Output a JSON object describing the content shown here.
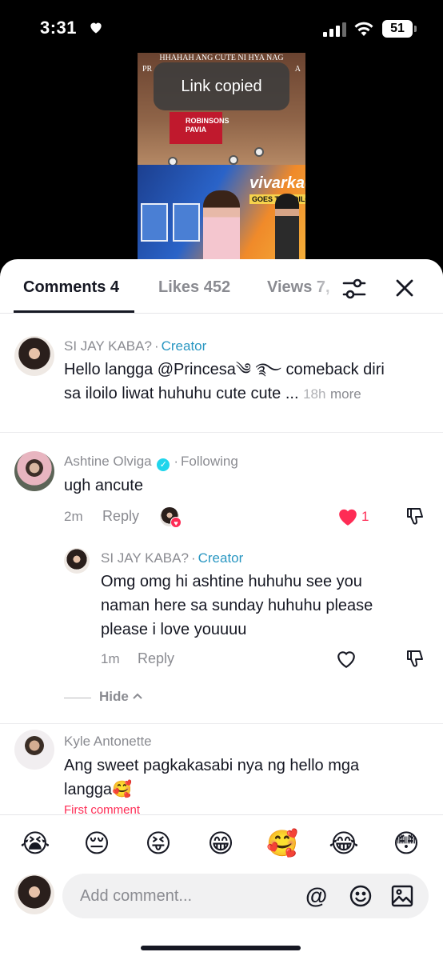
{
  "status": {
    "time": "3:31",
    "battery": "51"
  },
  "video": {
    "caption_line1": "HHAHAH ANG CUTE NI HYA NAG",
    "caption_line2": "PR",
    "caption_line2_end": "A",
    "sign": "ROBINSONS PAVIA",
    "board": "vivarkada",
    "board_sub": "GOES TO ILOILO",
    "toast": "Link copied"
  },
  "tabs": [
    {
      "label": "Comments 4"
    },
    {
      "label": "Likes 452"
    },
    {
      "label": "Views 7,"
    }
  ],
  "comments": [
    {
      "name": "SI JAY KABA?",
      "badge": "Creator",
      "text_line1": "Hello langga @Princesa༄ ࿐ comeback diri",
      "text_line2": "sa iloilo liwat huhuhu cute cute ...",
      "time": "18h",
      "more": "more"
    },
    {
      "name": "Ashtine Olviga",
      "badge": "Following",
      "text": "ugh ancute",
      "time": "2m",
      "reply": "Reply",
      "likes": "1"
    },
    {
      "name": "SI JAY KABA?",
      "badge": "Creator",
      "text_line1": "Omg omg hi ashtine huhuhu see you",
      "text_line2": "naman here sa sunday huhuhu please",
      "text_line3": "please i love youuuu",
      "time": "1m",
      "reply": "Reply"
    },
    {
      "name": "Kyle Antonette",
      "text_line1": "Ang sweet pagkakasabi nya ng hello mga",
      "text_line2": "langga🥰",
      "tag": "First comment"
    }
  ],
  "hide_label": "Hide",
  "emojis": [
    "😭",
    "😔",
    "😝",
    "😁",
    "🥰",
    "😂",
    "😳"
  ],
  "input": {
    "placeholder": "Add comment...",
    "at": "@"
  },
  "colors": {
    "accent": "#fe2c55",
    "creator": "#2a97c2",
    "verified": "#20d5ec"
  },
  "icons": [
    "heart-icon",
    "signal-icon",
    "wifi-icon",
    "battery-icon",
    "filter-icon",
    "close-icon",
    "like-icon",
    "dislike-icon",
    "smile-icon",
    "image-icon",
    "chevron-up-icon"
  ]
}
